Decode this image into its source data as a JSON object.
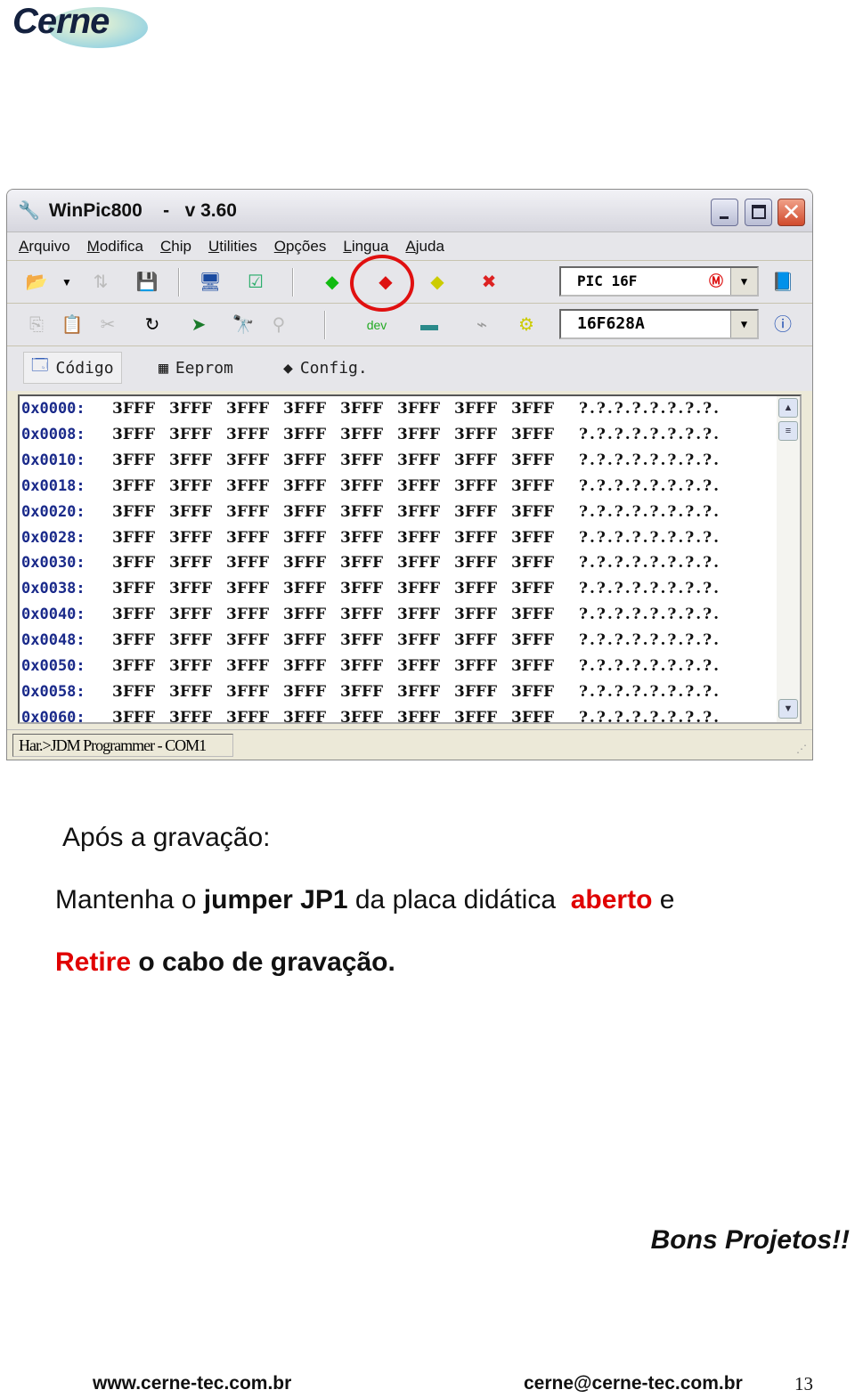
{
  "logo": "Cerne",
  "window": {
    "title": "WinPic800    -   v 3.60",
    "menu": [
      "Arquivo",
      "Modifica",
      "Chip",
      "Utilities",
      "Opções",
      "Lingua",
      "Ajuda"
    ],
    "family_combo": "PIC 16F",
    "device_combo": "16F628A",
    "tabs": [
      "Código",
      "Eeprom",
      "Config."
    ],
    "rows": [
      {
        "addr": "0x0000:",
        "ascii": "?.?.?.?.?.?.?.?."
      },
      {
        "addr": "0x0008:",
        "ascii": "?.?.?.?.?.?.?.?."
      },
      {
        "addr": "0x0010:",
        "ascii": "?.?.?.?.?.?.?.?."
      },
      {
        "addr": "0x0018:",
        "ascii": "?.?.?.?.?.?.?.?."
      },
      {
        "addr": "0x0020:",
        "ascii": "?.?.?.?.?.?.?.?."
      },
      {
        "addr": "0x0028:",
        "ascii": "?.?.?.?.?.?.?.?."
      },
      {
        "addr": "0x0030:",
        "ascii": "?.?.?.?.?.?.?.?."
      },
      {
        "addr": "0x0038:",
        "ascii": "?.?.?.?.?.?.?.?."
      },
      {
        "addr": "0x0040:",
        "ascii": "?.?.?.?.?.?.?.?."
      },
      {
        "addr": "0x0048:",
        "ascii": "?.?.?.?.?.?.?.?."
      },
      {
        "addr": "0x0050:",
        "ascii": "?.?.?.?.?.?.?.?."
      },
      {
        "addr": "0x0058:",
        "ascii": "?.?.?.?.?.?.?.?."
      },
      {
        "addr": "0x0060:",
        "ascii": "?.?.?.?.?.?.?.?."
      }
    ],
    "cell_value": "3FFF",
    "status": "Har.>JDM Programmer - COM1"
  },
  "text": {
    "heading": "Após a gravação:",
    "line1_a": "Mantenha o ",
    "line1_b": "jumper JP1",
    "line1_c": " da placa didática  ",
    "line1_d": "aberto",
    "line1_e": " e",
    "line2_a": "Retire",
    "line2_b": " o cabo de gravação.",
    "closing": "Bons Projetos!!"
  },
  "footer": {
    "site": "www.cerne-tec.com.br",
    "email": "cerne@cerne-tec.com.br",
    "page": "13"
  },
  "colors": {
    "highlight": "#e00000",
    "address": "#1a2a8a"
  }
}
